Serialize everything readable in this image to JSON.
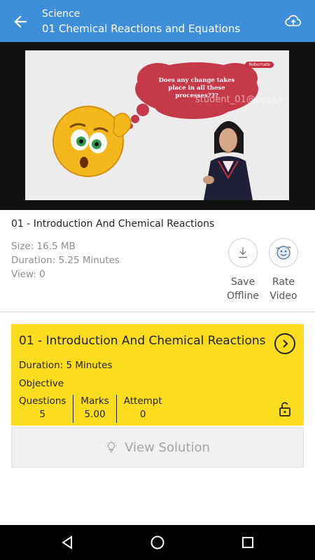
{
  "appbar": {
    "subject": "Science",
    "chapter": "01 Chemical Reactions and Equations",
    "back_icon": "arrow-left-icon",
    "cloud_icon": "cloud-sync-icon",
    "color": "#3f8fd8"
  },
  "video": {
    "bubble_text_line1": "Does any change takes",
    "bubble_text_line2": "place in all these",
    "bubble_text_line3": "processes???",
    "watermark": "student_01@ceoan",
    "logo": "Robomate"
  },
  "lesson": {
    "title": "01 - Introduction And Chemical Reactions",
    "size": "Size: 16.5 MB",
    "duration": "Duration: 5.25 Minutes",
    "views": "View: 0",
    "save_label_line1": "Save",
    "save_label_line2": "Offline",
    "rate_label_line1": "Rate",
    "rate_label_line2": "Video"
  },
  "quiz": {
    "title": "01 - Introduction And Chemical Reactions",
    "duration": "Duration: 5 Minutes",
    "type": "Objective",
    "questions_label": "Questions",
    "questions_value": "5",
    "marks_label": "Marks",
    "marks_value": "5.00",
    "attempt_label": "Attempt",
    "attempt_value": "0",
    "color": "#fbdc1e"
  },
  "solution": {
    "label": "View Solution"
  }
}
